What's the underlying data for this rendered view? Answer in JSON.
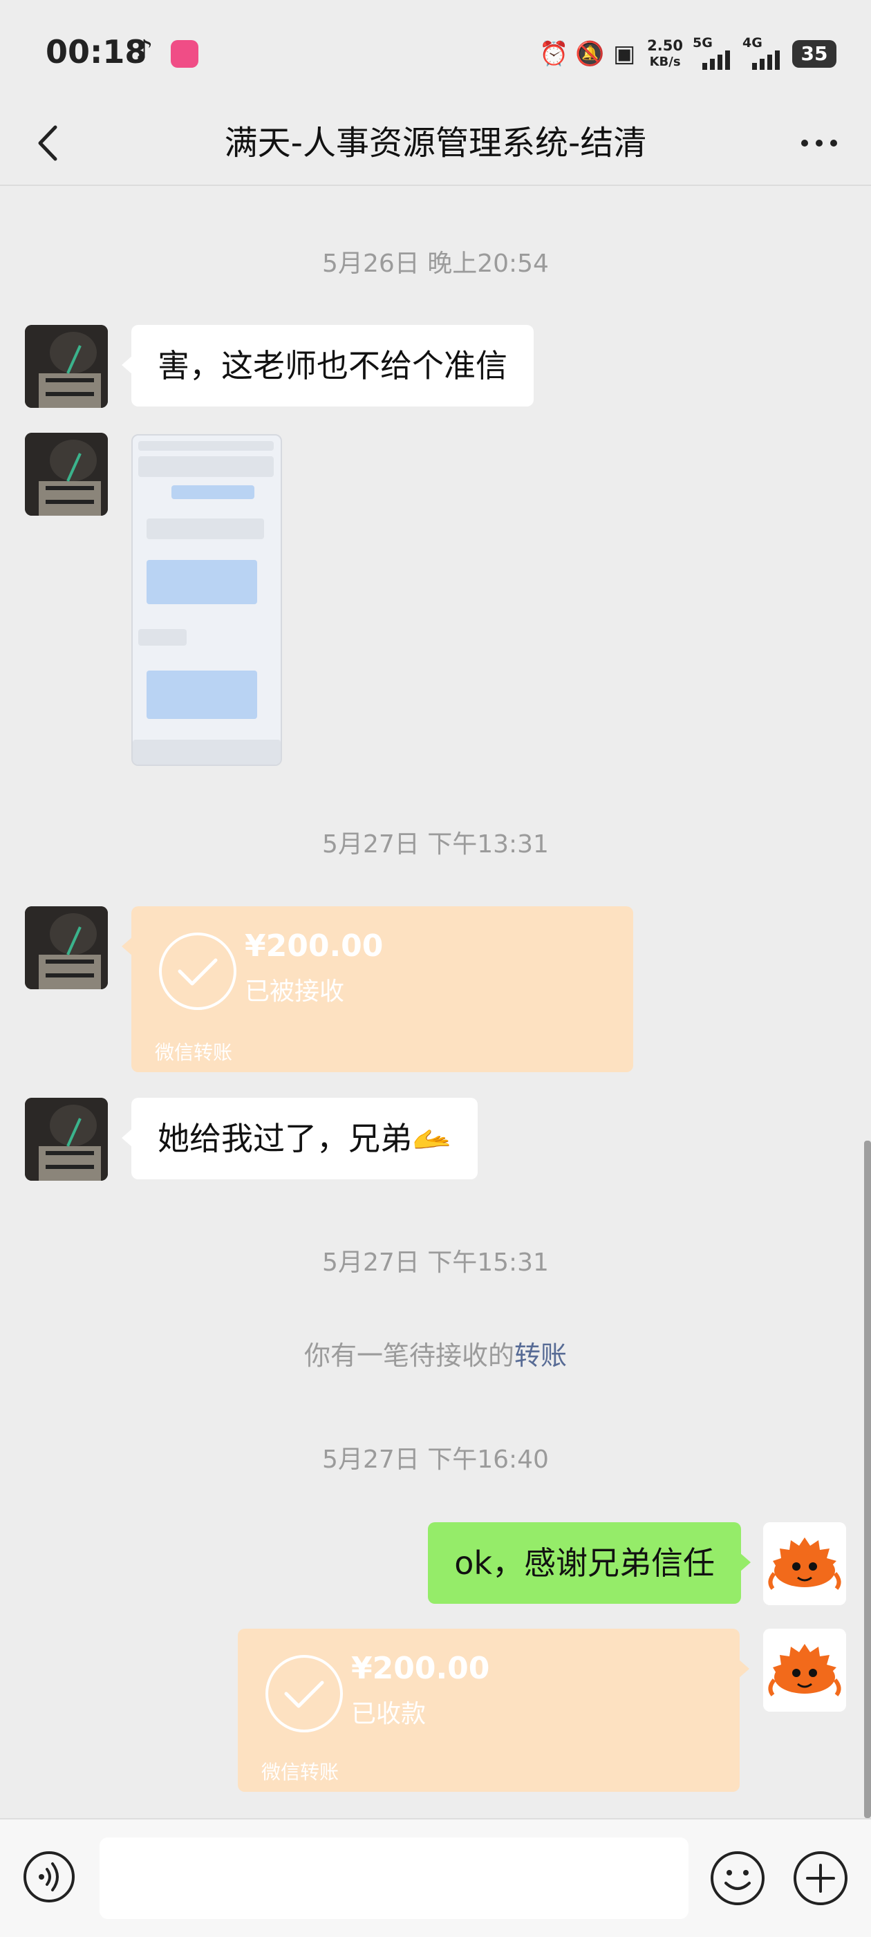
{
  "status_bar": {
    "time": "00:18",
    "net_speed": "2.50",
    "net_speed_unit": "KB/s",
    "sim1": "5G",
    "sim2": "4G",
    "battery": "35"
  },
  "header": {
    "title": "满天-人事资源管理系统-结清"
  },
  "messages": {
    "ts1": "5月26日 晚上20:54",
    "msg1": "害，这老师也不给个准信",
    "ts2": "5月27日 下午13:31",
    "transfer1": {
      "amount": "¥200.00",
      "status": "已被接收",
      "footer": "微信转账"
    },
    "msg2": "她给我过了，兄弟🫴",
    "ts3": "5月27日 下午15:31",
    "system_prefix": "你有一笔待接收的",
    "system_link": "转账",
    "ts4": "5月27日 下午16:40",
    "msg3": "ok，感谢兄弟信任",
    "transfer2": {
      "amount": "¥200.00",
      "status": "已收款",
      "footer": "微信转账"
    }
  },
  "colors": {
    "background": "#ededed",
    "self_bubble": "#95ec69",
    "transfer_card": "#fde1c1",
    "link": "#576b95"
  },
  "icons": [
    "back-icon",
    "more-icon",
    "voice-icon",
    "emoji-icon",
    "plus-icon",
    "check-circle-icon",
    "alarm-icon",
    "mute-icon",
    "contact-icon"
  ]
}
